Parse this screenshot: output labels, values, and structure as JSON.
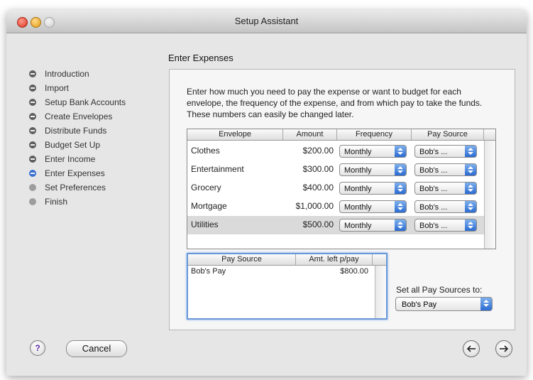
{
  "window": {
    "title": "Setup Assistant"
  },
  "steps": [
    {
      "label": "Introduction",
      "state": "done"
    },
    {
      "label": "Import",
      "state": "done"
    },
    {
      "label": "Setup Bank Accounts",
      "state": "done"
    },
    {
      "label": "Create Envelopes",
      "state": "done"
    },
    {
      "label": "Distribute Funds",
      "state": "done"
    },
    {
      "label": "Budget Set Up",
      "state": "done"
    },
    {
      "label": "Enter Income",
      "state": "done"
    },
    {
      "label": "Enter Expenses",
      "state": "current"
    },
    {
      "label": "Set Preferences",
      "state": "pending"
    },
    {
      "label": "Finish",
      "state": "pending"
    }
  ],
  "main": {
    "heading": "Enter Expenses",
    "description": "Enter how much you need to pay the expense or want to budget for each envelope, the frequency of the expense, and from which pay to take the funds.  These numbers can easily be changed later.",
    "expense_table": {
      "columns": [
        "Envelope",
        "Amount",
        "Frequency",
        "Pay Source"
      ],
      "rows": [
        {
          "envelope": "Clothes",
          "amount": "$200.00",
          "frequency": "Monthly",
          "pay_source": "Bob's ...",
          "selected": false
        },
        {
          "envelope": "Entertainment",
          "amount": "$300.00",
          "frequency": "Monthly",
          "pay_source": "Bob's ...",
          "selected": false
        },
        {
          "envelope": "Grocery",
          "amount": "$400.00",
          "frequency": "Monthly",
          "pay_source": "Bob's ...",
          "selected": false
        },
        {
          "envelope": "Mortgage",
          "amount": "$1,000.00",
          "frequency": "Monthly",
          "pay_source": "Bob's ...",
          "selected": false
        },
        {
          "envelope": "Utilities",
          "amount": "$500.00",
          "frequency": "Monthly",
          "pay_source": "Bob's ...",
          "selected": true
        }
      ]
    },
    "pay_source_table": {
      "columns": [
        "Pay Source",
        "Amt. left p/pay"
      ],
      "rows": [
        {
          "pay_source": "Bob's Pay",
          "amount_left": "$800.00"
        }
      ]
    },
    "set_all": {
      "label": "Set all Pay Sources to:",
      "value": "Bob's Pay"
    }
  },
  "footer": {
    "help_label": "?",
    "cancel_label": "Cancel"
  },
  "colors": {
    "accent": "#2b6cd1",
    "selection": "#dadada"
  }
}
